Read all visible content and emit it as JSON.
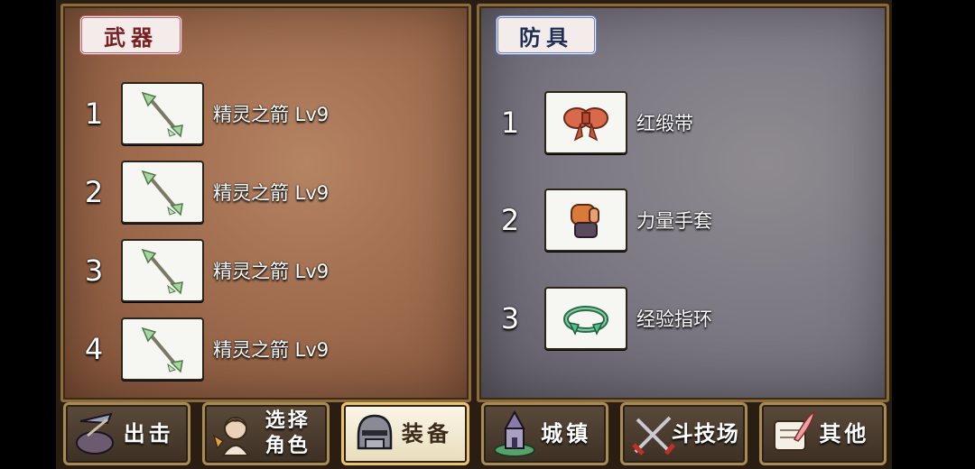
{
  "weapons": {
    "title": "武器",
    "items": [
      {
        "index": "1",
        "name": "精灵之箭 Lv9",
        "icon": "elf-arrow-icon"
      },
      {
        "index": "2",
        "name": "精灵之箭 Lv9",
        "icon": "elf-arrow-icon"
      },
      {
        "index": "3",
        "name": "精灵之箭 Lv9",
        "icon": "elf-arrow-icon"
      },
      {
        "index": "4",
        "name": "精灵之箭 Lv9",
        "icon": "elf-arrow-icon"
      }
    ]
  },
  "armor": {
    "title": "防具",
    "items": [
      {
        "index": "1",
        "name": "红缎带",
        "icon": "red-ribbon-icon"
      },
      {
        "index": "2",
        "name": "力量手套",
        "icon": "power-glove-icon"
      },
      {
        "index": "3",
        "name": "经验指环",
        "icon": "exp-ring-icon"
      }
    ]
  },
  "nav": {
    "sortie": "出击",
    "select_line1": "选择",
    "select_line2": "角色",
    "equipment": "装备",
    "town": "城镇",
    "arena": "斗技场",
    "other": "其他",
    "active": "equipment"
  }
}
